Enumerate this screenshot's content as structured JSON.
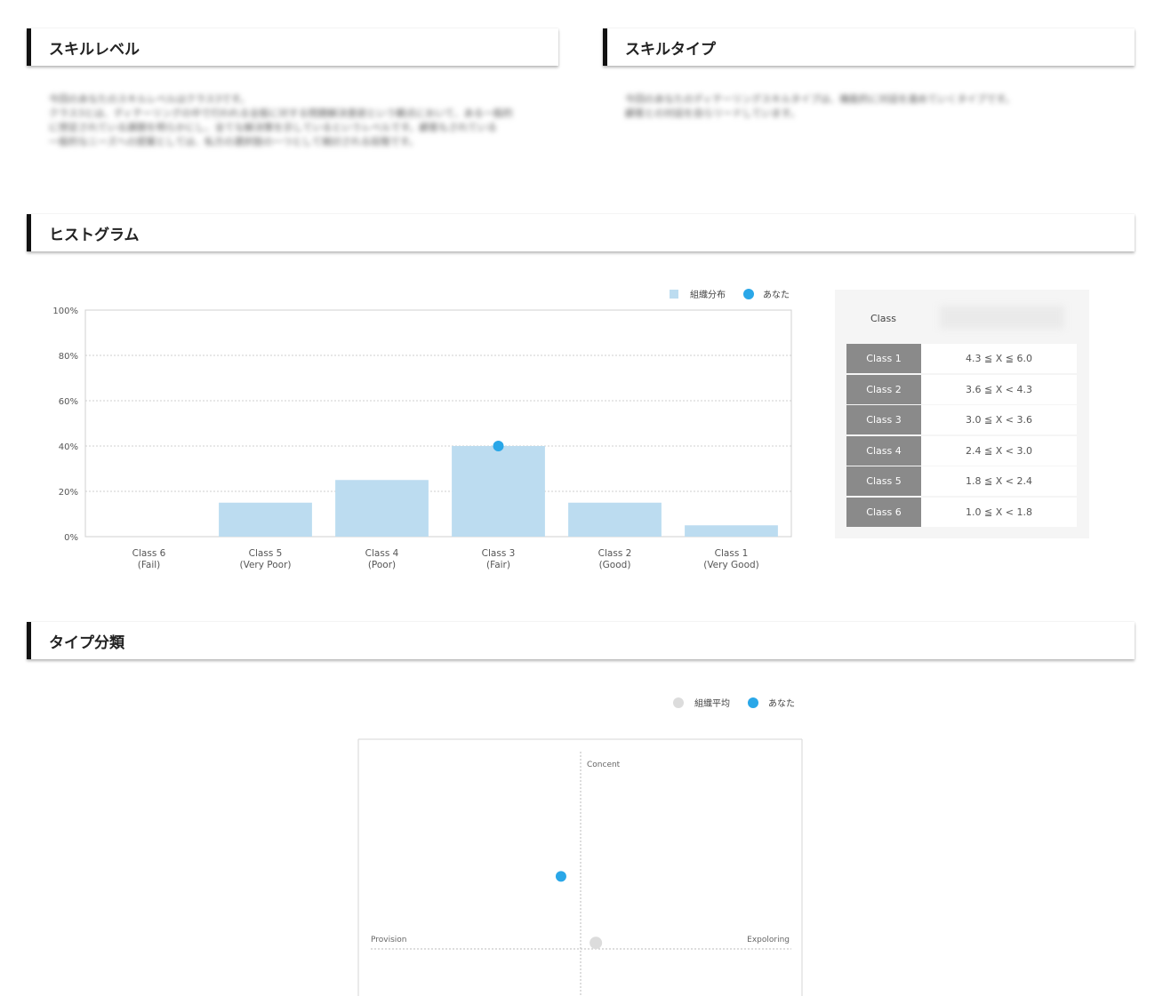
{
  "sections": {
    "skill_level": {
      "title": "スキルレベル",
      "description": "今回のあなたのスキルレベルはクラス3です。\nクラス3とは、ディテーリングの中で行われる全般に対する問題解決意欲という観点において、ある一般的\nに想定されている課題を明らかにし、全てな解決策を示しているというレベルです。顧客もされている\n一般的なニーズへの提案としては、私方の選択肢の一つとして検討される段階です。"
    },
    "skill_type": {
      "title": "スキルタイプ",
      "description": "今回のあなたのディテーリングスキルタイプは、機能的に対話を進めていくタイプです。\n顧客との対話を自らリードしています。"
    },
    "histogram": {
      "title": "ヒストグラム"
    },
    "type_classification": {
      "title": "タイプ分類"
    }
  },
  "histogram_legend": {
    "distribution": "組織分布",
    "you": "あなた"
  },
  "scatter_legend": {
    "average": "組織平均",
    "you": "あなた"
  },
  "colors": {
    "bar": "#bcdcf0",
    "you": "#2aa7e8",
    "average": "#dcdcdc",
    "grid": "#cfcfcf",
    "cell": "#8a8a8a"
  },
  "class_table": {
    "header": "Class",
    "rows": [
      {
        "class": "Class 1",
        "range": "4.3 ≦ X ≦ 6.0"
      },
      {
        "class": "Class 2",
        "range": "3.6 ≦ X < 4.3"
      },
      {
        "class": "Class 3",
        "range": "3.0 ≦ X < 3.6"
      },
      {
        "class": "Class 4",
        "range": "2.4 ≦ X < 3.0"
      },
      {
        "class": "Class 5",
        "range": "1.8 ≦ X < 2.4"
      },
      {
        "class": "Class 6",
        "range": "1.0 ≦ X < 1.8"
      }
    ]
  },
  "chart_data": [
    {
      "type": "bar",
      "categories": [
        "Class 6\n(Fail)",
        "Class 5\n(Very Poor)",
        "Class 4\n(Poor)",
        "Class 3\n(Fair)",
        "Class 2\n(Good)",
        "Class 1\n(Very Good)"
      ],
      "series": [
        {
          "name": "組織分布",
          "values": [
            0,
            15,
            25,
            40,
            15,
            5
          ]
        },
        {
          "name": "あなた",
          "marker": "dot",
          "category_index": 3,
          "value": 40
        }
      ],
      "yticks": [
        "0%",
        "20%",
        "40%",
        "60%",
        "80%",
        "100%"
      ],
      "ylim": [
        0,
        100
      ],
      "grid": true,
      "legend": "top-right"
    },
    {
      "type": "scatter",
      "axes": {
        "top": "Concent",
        "left": "Provision",
        "right": "Expoloring"
      },
      "xlim": [
        -1,
        1
      ],
      "ylim": [
        -1,
        1
      ],
      "series": [
        {
          "name": "あなた",
          "x": -0.09,
          "y": 0.6
        },
        {
          "name": "組織平均",
          "x": 0.07,
          "y": 0.05
        }
      ],
      "legend": "top-right"
    }
  ]
}
